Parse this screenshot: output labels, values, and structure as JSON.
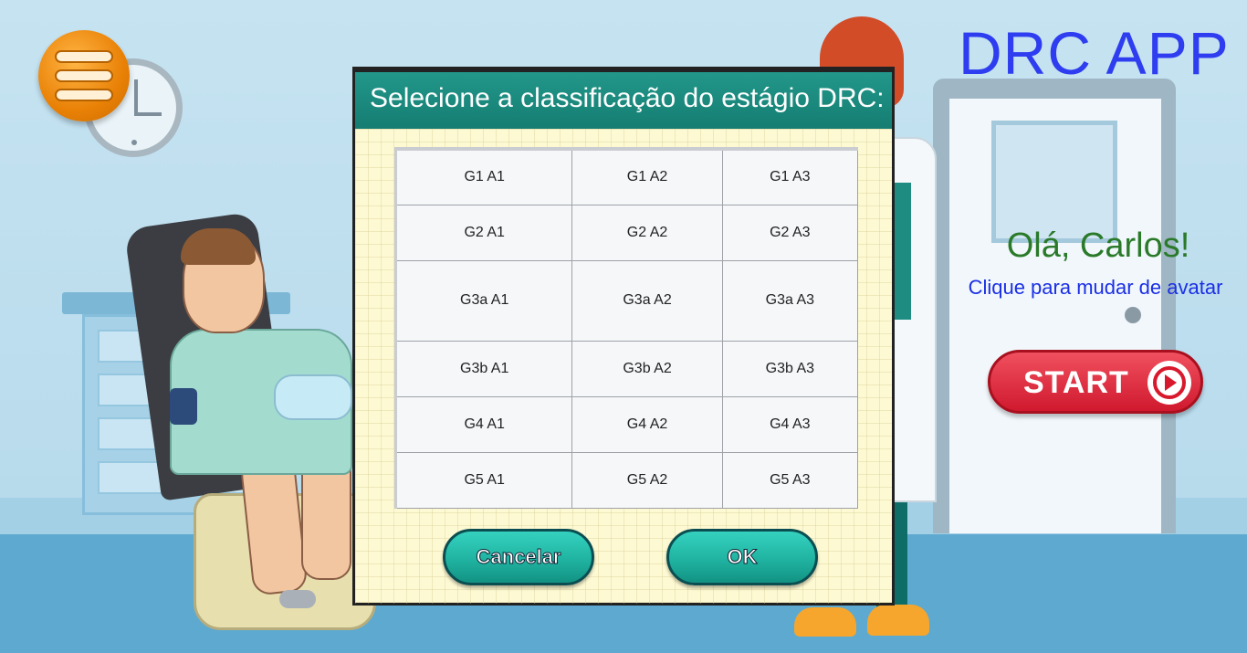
{
  "app": {
    "title": "DRC APP",
    "greeting": "Olá, Carlos!",
    "avatar_link": "Clique para mudar de avatar",
    "start_label": "START",
    "menu_icon": "hamburger-menu-icon",
    "start_icon": "play-circle-icon"
  },
  "dialog": {
    "title": "Selecione a classificação do estágio DRC:",
    "rows": [
      [
        "G1 A1",
        "G1 A2",
        "G1 A3"
      ],
      [
        "G2 A1",
        "G2 A2",
        "G2 A3"
      ],
      [
        "G3a A1",
        "G3a A2",
        "G3a A3"
      ],
      [
        "G3b A1",
        "G3b A2",
        "G3b A3"
      ],
      [
        "G4 A1",
        "G4 A2",
        "G4 A3"
      ],
      [
        "G5 A1",
        "G5 A2",
        "G5 A3"
      ]
    ],
    "cancel_label": "Cancelar",
    "ok_label": "OK"
  },
  "colors": {
    "title_blue": "#2e3df0",
    "greeting_green": "#2a7a2a",
    "link_blue": "#1b2fe6",
    "start_red": "#d0192e",
    "dialog_teal": "#1a8a7e",
    "button_teal": "#20b3a1",
    "menu_orange": "#e98106"
  }
}
